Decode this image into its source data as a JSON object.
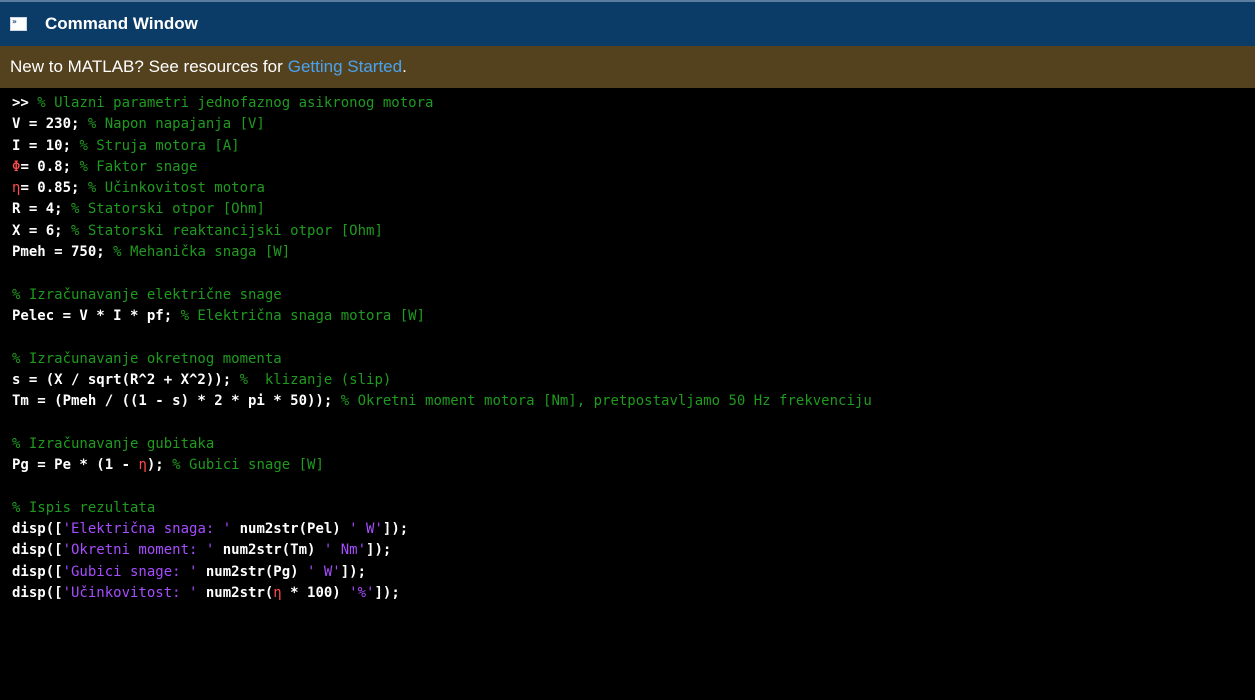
{
  "window": {
    "title": "Command Window",
    "icon": "command-window-icon"
  },
  "banner": {
    "text": "New to MATLAB? See resources for",
    "link": "Getting Started",
    "suffix": "."
  },
  "code_lines": [
    [
      [
        "k",
        ">> "
      ],
      [
        "c",
        "% Ulazni parametri jednofaznog asikronog motora"
      ]
    ],
    [
      [
        "k",
        "V = 230; "
      ],
      [
        "c",
        "% Napon napajanja [V]"
      ]
    ],
    [
      [
        "k",
        "I = 10; "
      ],
      [
        "c",
        "% Struja motora [A]"
      ]
    ],
    [
      [
        "e",
        "Φ"
      ],
      [
        "k",
        "= 0.8; "
      ],
      [
        "c",
        "% Faktor snage"
      ]
    ],
    [
      [
        "e",
        "η"
      ],
      [
        "k",
        "= 0.85; "
      ],
      [
        "c",
        "% Učinkovitost motora"
      ]
    ],
    [
      [
        "k",
        "R = 4; "
      ],
      [
        "c",
        "% Statorski otpor [Ohm]"
      ]
    ],
    [
      [
        "k",
        "X = 6; "
      ],
      [
        "c",
        "% Statorski reaktancijski otpor [Ohm]"
      ]
    ],
    [
      [
        "k",
        "Pmeh = 750; "
      ],
      [
        "c",
        "% Mehanička snaga [W]"
      ]
    ],
    [],
    [
      [
        "c",
        "% Izračunavanje električne snage"
      ]
    ],
    [
      [
        "k",
        "Pelec = V * I * pf; "
      ],
      [
        "c",
        "% Električna snaga motora [W]"
      ]
    ],
    [],
    [
      [
        "c",
        "% Izračunavanje okretnog momenta"
      ]
    ],
    [
      [
        "k",
        "s = (X / sqrt(R^2 + X^2)); "
      ],
      [
        "c",
        "%  klizanje (slip)"
      ]
    ],
    [
      [
        "k",
        "Tm = (Pmeh / ((1 - s) * 2 * pi * 50)); "
      ],
      [
        "c",
        "% Okretni moment motora [Nm], pretpostavljamo 50 Hz frekvenciju"
      ]
    ],
    [],
    [
      [
        "c",
        "% Izračunavanje gubitaka"
      ]
    ],
    [
      [
        "k",
        "Pg = Pe * (1 - "
      ],
      [
        "e",
        "η"
      ],
      [
        "k",
        "); "
      ],
      [
        "c",
        "% Gubici snage [W]"
      ]
    ],
    [],
    [
      [
        "c",
        "% Ispis rezultata"
      ]
    ],
    [
      [
        "k",
        "disp(["
      ],
      [
        "s",
        "'Električna snaga: '"
      ],
      [
        "k",
        " num2str(Pel) "
      ],
      [
        "s",
        "' W'"
      ],
      [
        "k",
        "]);"
      ]
    ],
    [
      [
        "k",
        "disp(["
      ],
      [
        "s",
        "'Okretni moment: '"
      ],
      [
        "k",
        " num2str(Tm) "
      ],
      [
        "s",
        "' Nm'"
      ],
      [
        "k",
        "]);"
      ]
    ],
    [
      [
        "k",
        "disp(["
      ],
      [
        "s",
        "'Gubici snage: '"
      ],
      [
        "k",
        " num2str(Pg) "
      ],
      [
        "s",
        "' W'"
      ],
      [
        "k",
        "]);"
      ]
    ],
    [
      [
        "k",
        "disp(["
      ],
      [
        "s",
        "'Učinkovitost: '"
      ],
      [
        "k",
        " num2str("
      ],
      [
        "e",
        "η"
      ],
      [
        "k",
        " * 100) "
      ],
      [
        "s",
        "'%'"
      ],
      [
        "k",
        "]);"
      ]
    ]
  ],
  "colors": {
    "titlebar": "#0b3c68",
    "banner": "#54421f",
    "link": "#4aa3ef",
    "comment": "#1f9a1f",
    "string": "#a64dff",
    "error": "#ff4d4d",
    "background": "#000000"
  }
}
